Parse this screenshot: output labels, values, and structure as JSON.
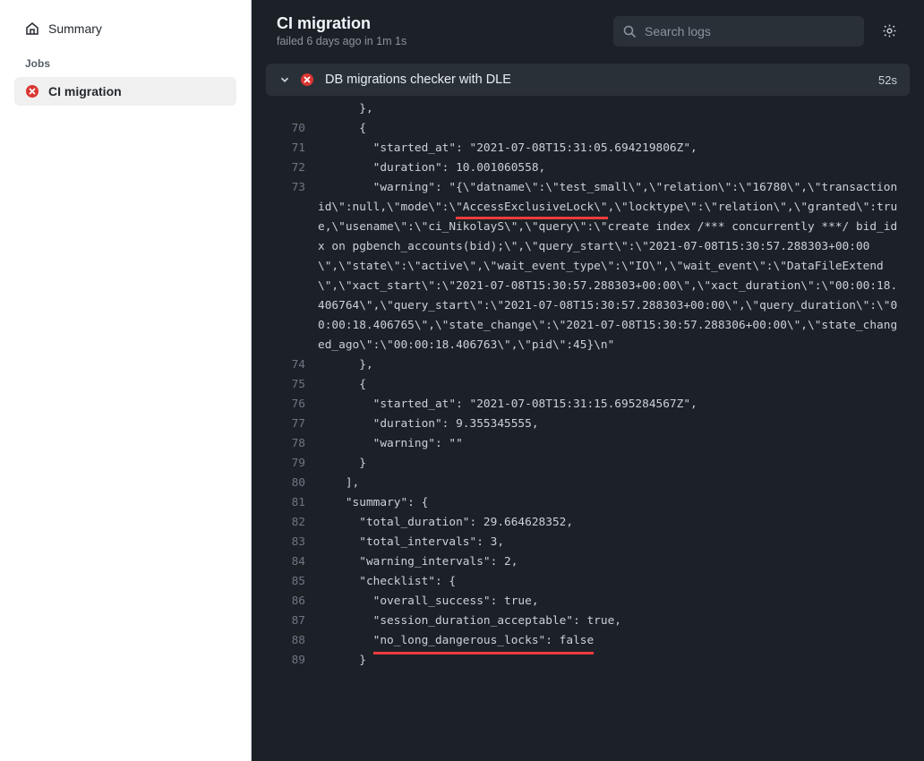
{
  "sidebar": {
    "summary_label": "Summary",
    "jobs_label": "Jobs",
    "job_name": "CI migration"
  },
  "header": {
    "title": "CI migration",
    "status_prefix": "failed ",
    "status_time": "6 days ago",
    "status_mid": " in ",
    "status_dur": "1m 1s",
    "search_placeholder": "Search logs"
  },
  "step": {
    "title": "DB migrations checker with DLE",
    "duration": "52s"
  },
  "log": {
    "lines": [
      {
        "n": "",
        "seg": [
          {
            "t": "      },",
            "h": 0
          }
        ]
      },
      {
        "n": "70",
        "seg": [
          {
            "t": "      {",
            "h": 0
          }
        ]
      },
      {
        "n": "71",
        "seg": [
          {
            "t": "        \"started_at\": \"2021-07-08T15:31:05.694219806Z\",",
            "h": 0
          }
        ]
      },
      {
        "n": "72",
        "seg": [
          {
            "t": "        \"duration\": 10.001060558,",
            "h": 0
          }
        ]
      },
      {
        "n": "73",
        "seg": [
          {
            "t": "        \"warning\": \"{\\\"datname\\\":\\\"test_small\\\",\\\"relation\\\":\\\"16780\\\",\\\"transactionid\\\":null,\\\"mode\\\":\\",
            "h": 0
          },
          {
            "t": "\"AccessExclusiveLock\\\"",
            "h": 1
          },
          {
            "t": ",\\\"locktype\\\":\\\"relation\\\",\\\"granted\\\":true,\\\"usename\\\":\\\"ci_NikolayS\\\",\\\"query\\\":\\\"create index /*** concurrently ***/ bid_idx on pgbench_accounts(bid);\\\",\\\"query_start\\\":\\\"2021-07-08T15:30:57.288303+00:00\\\",\\\"state\\\":\\\"active\\\",\\\"wait_event_type\\\":\\\"IO\\\",\\\"wait_event\\\":\\\"DataFileExtend\\\",\\\"xact_start\\\":\\\"2021-07-08T15:30:57.288303+00:00\\\",\\\"xact_duration\\\":\\\"00:00:18.406764\\\",\\\"query_start\\\":\\\"2021-07-08T15:30:57.288303+00:00\\\",\\\"query_duration\\\":\\\"00:00:18.406765\\\",\\\"state_change\\\":\\\"2021-07-08T15:30:57.288306+00:00\\\",\\\"state_changed_ago\\\":\\\"00:00:18.406763\\\",\\\"pid\\\":45}\\n\"",
            "h": 0
          }
        ]
      },
      {
        "n": "74",
        "seg": [
          {
            "t": "      },",
            "h": 0
          }
        ]
      },
      {
        "n": "75",
        "seg": [
          {
            "t": "      {",
            "h": 0
          }
        ]
      },
      {
        "n": "76",
        "seg": [
          {
            "t": "        \"started_at\": \"2021-07-08T15:31:15.695284567Z\",",
            "h": 0
          }
        ]
      },
      {
        "n": "77",
        "seg": [
          {
            "t": "        \"duration\": 9.355345555,",
            "h": 0
          }
        ]
      },
      {
        "n": "78",
        "seg": [
          {
            "t": "        \"warning\": \"\"",
            "h": 0
          }
        ]
      },
      {
        "n": "79",
        "seg": [
          {
            "t": "      }",
            "h": 0
          }
        ]
      },
      {
        "n": "80",
        "seg": [
          {
            "t": "    ],",
            "h": 0
          }
        ]
      },
      {
        "n": "81",
        "seg": [
          {
            "t": "    \"summary\": {",
            "h": 0
          }
        ]
      },
      {
        "n": "82",
        "seg": [
          {
            "t": "      \"total_duration\": 29.664628352,",
            "h": 0
          }
        ]
      },
      {
        "n": "83",
        "seg": [
          {
            "t": "      \"total_intervals\": 3,",
            "h": 0
          }
        ]
      },
      {
        "n": "84",
        "seg": [
          {
            "t": "      \"warning_intervals\": 2,",
            "h": 0
          }
        ]
      },
      {
        "n": "85",
        "seg": [
          {
            "t": "      \"checklist\": {",
            "h": 0
          }
        ]
      },
      {
        "n": "86",
        "seg": [
          {
            "t": "        \"overall_success\": true,",
            "h": 0
          }
        ]
      },
      {
        "n": "87",
        "seg": [
          {
            "t": "        \"session_duration_acceptable\": true,",
            "h": 0
          }
        ]
      },
      {
        "n": "88",
        "seg": [
          {
            "t": "        ",
            "h": 0
          },
          {
            "t": "\"no_long_dangerous_locks\": false",
            "h": 2
          }
        ]
      },
      {
        "n": "89",
        "seg": [
          {
            "t": "      }",
            "h": 0
          }
        ]
      }
    ]
  }
}
